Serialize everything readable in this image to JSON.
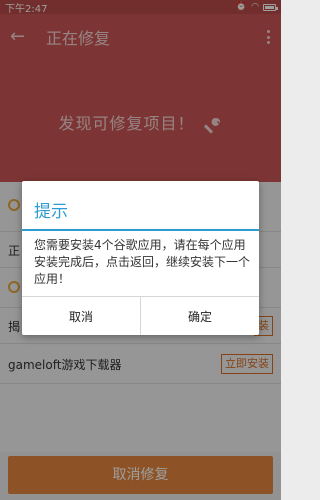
{
  "status_bar": {
    "time": "下午2:47"
  },
  "app_bar": {
    "title": "正在修复"
  },
  "banner": {
    "text": "发现可修复项目！"
  },
  "list": {
    "row1_text": "正",
    "row2_text": "揭",
    "items": [
      {
        "name": "gameloft游戏下载器",
        "action": "立即安装"
      }
    ],
    "partial_action": "装"
  },
  "footer": {
    "cancel_label": "取消修复"
  },
  "dialog": {
    "title": "提示",
    "message": "您需要安装4个谷歌应用，请在每个应用安装完成后，点击返回，继续安装下一个应用！",
    "cancel_label": "取消",
    "confirm_label": "确定"
  },
  "colors": {
    "header_red": "#c95654",
    "accent_blue": "#2f9bd3",
    "accent_orange": "#e4873e"
  }
}
